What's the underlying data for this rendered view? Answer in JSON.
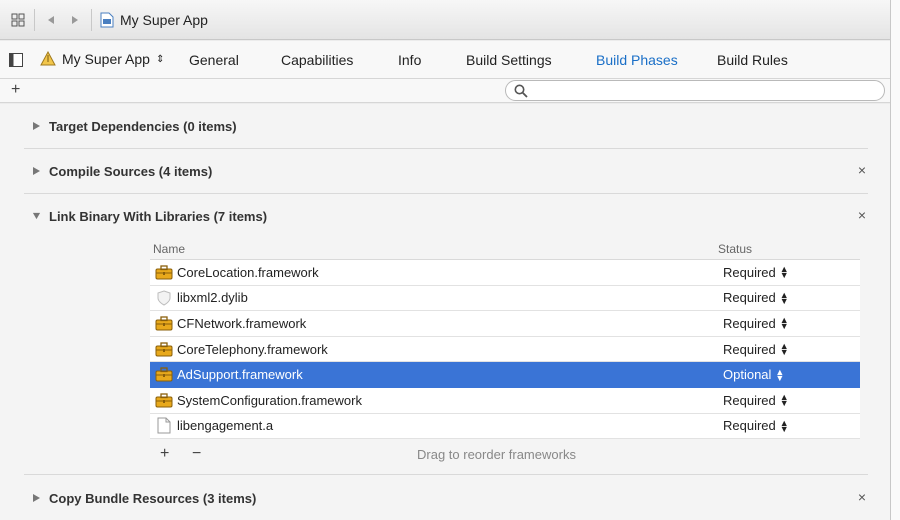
{
  "jumpbar": {
    "title": "My Super App"
  },
  "tabs": {
    "target": "My Super App",
    "items": [
      "General",
      "Capabilities",
      "Info",
      "Build Settings",
      "Build Phases",
      "Build Rules"
    ],
    "active": "Build Phases"
  },
  "filter": {
    "placeholder": ""
  },
  "phases": [
    {
      "title": "Target Dependencies (0 items)",
      "closable": false
    },
    {
      "title": "Compile Sources (4 items)",
      "closable": true
    },
    {
      "title": "Link Binary With Libraries (7 items)",
      "closable": true,
      "expanded": true
    },
    {
      "title": "Copy Bundle Resources (3 items)",
      "closable": true
    }
  ],
  "libraries": {
    "col_name": "Name",
    "col_status": "Status",
    "rows": [
      {
        "name": "CoreLocation.framework",
        "status": "Required",
        "icon": "toolbox-icon"
      },
      {
        "name": "libxml2.dylib",
        "status": "Required",
        "icon": "library-shield-icon"
      },
      {
        "name": "CFNetwork.framework",
        "status": "Required",
        "icon": "toolbox-icon"
      },
      {
        "name": "CoreTelephony.framework",
        "status": "Required",
        "icon": "toolbox-icon"
      },
      {
        "name": "AdSupport.framework",
        "status": "Optional",
        "icon": "toolbox-icon",
        "selected": true
      },
      {
        "name": "SystemConfiguration.framework",
        "status": "Required",
        "icon": "toolbox-icon"
      },
      {
        "name": "libengagement.a",
        "status": "Required",
        "icon": "document-icon"
      }
    ],
    "add_label": "+",
    "remove_label": "−",
    "hint": "Drag to reorder frameworks"
  },
  "close_glyph": "×",
  "add_top_label": "+"
}
